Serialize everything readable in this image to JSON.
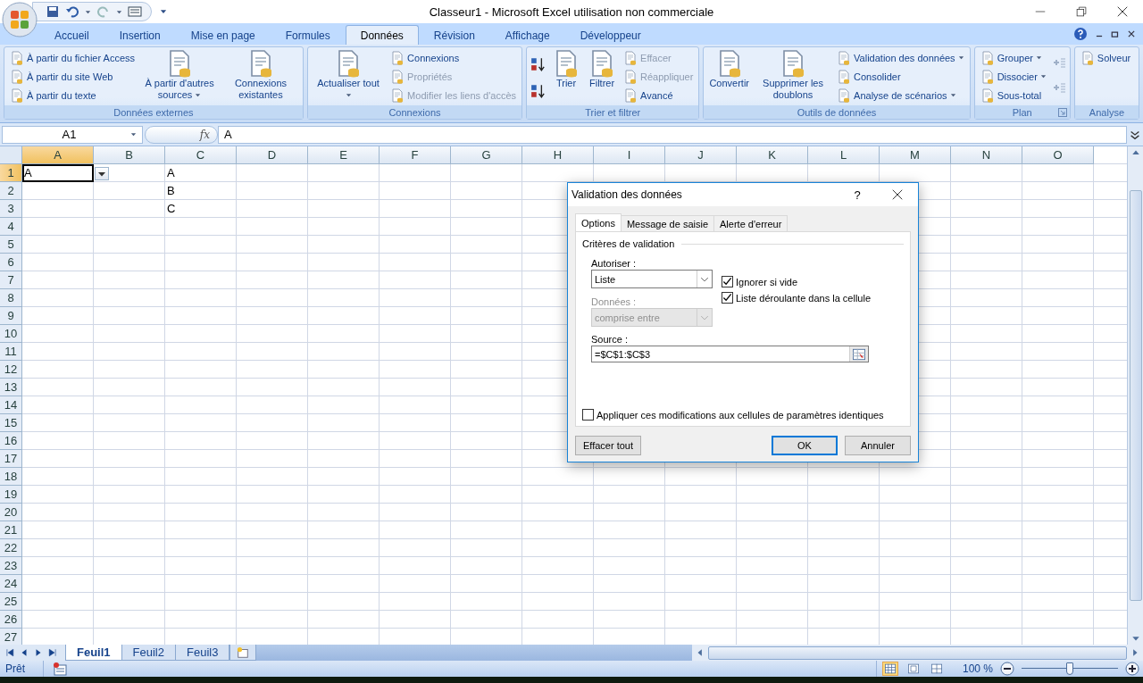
{
  "window": {
    "title": "Classeur1 - Microsoft Excel utilisation non commerciale"
  },
  "tabs": [
    {
      "label": "Accueil",
      "selected": false
    },
    {
      "label": "Insertion",
      "selected": false
    },
    {
      "label": "Mise en page",
      "selected": false
    },
    {
      "label": "Formules",
      "selected": false
    },
    {
      "label": "Données",
      "selected": true
    },
    {
      "label": "Révision",
      "selected": false
    },
    {
      "label": "Affichage",
      "selected": false
    },
    {
      "label": "Développeur",
      "selected": false
    }
  ],
  "ribbon": {
    "groups": [
      {
        "label": "Données externes",
        "launcher": false,
        "items": [
          {
            "kind": "small",
            "label": "À partir du fichier Access",
            "disabled": false,
            "dropdown": false
          },
          {
            "kind": "small",
            "label": "À partir du site Web",
            "disabled": false,
            "dropdown": false
          },
          {
            "kind": "small",
            "label": "À partir du texte",
            "disabled": false,
            "dropdown": false
          },
          {
            "kind": "large",
            "label": "À partir d'autres sources",
            "disabled": false,
            "dropdown": true
          },
          {
            "kind": "large",
            "label": "Connexions existantes",
            "disabled": false,
            "dropdown": false
          }
        ]
      },
      {
        "label": "Connexions",
        "launcher": false,
        "items": [
          {
            "kind": "large",
            "label": "Actualiser tout",
            "disabled": false,
            "dropdown": true
          },
          {
            "kind": "small",
            "label": "Connexions",
            "disabled": false,
            "dropdown": false
          },
          {
            "kind": "small",
            "label": "Propriétés",
            "disabled": true,
            "dropdown": false
          },
          {
            "kind": "small",
            "label": "Modifier les liens d'accès",
            "disabled": true,
            "dropdown": false
          }
        ]
      },
      {
        "label": "Trier et filtrer",
        "launcher": false,
        "items": [
          {
            "kind": "sort"
          },
          {
            "kind": "large",
            "label": "Trier",
            "disabled": false,
            "dropdown": false
          },
          {
            "kind": "large",
            "label": "Filtrer",
            "disabled": false,
            "dropdown": false
          },
          {
            "kind": "small",
            "label": "Effacer",
            "disabled": true,
            "dropdown": false
          },
          {
            "kind": "small",
            "label": "Réappliquer",
            "disabled": true,
            "dropdown": false
          },
          {
            "kind": "small",
            "label": "Avancé",
            "disabled": false,
            "dropdown": false
          }
        ]
      },
      {
        "label": "Outils de données",
        "launcher": false,
        "items": [
          {
            "kind": "large",
            "label": "Convertir",
            "disabled": false,
            "dropdown": false
          },
          {
            "kind": "large",
            "label": "Supprimer les doublons",
            "disabled": false,
            "dropdown": false
          },
          {
            "kind": "small",
            "label": "Validation des données",
            "disabled": false,
            "dropdown": true
          },
          {
            "kind": "small",
            "label": "Consolider",
            "disabled": false,
            "dropdown": false
          },
          {
            "kind": "small",
            "label": "Analyse de scénarios",
            "disabled": false,
            "dropdown": true
          }
        ]
      },
      {
        "label": "Plan",
        "launcher": true,
        "items": [
          {
            "kind": "small",
            "label": "Grouper",
            "disabled": false,
            "dropdown": true
          },
          {
            "kind": "small",
            "label": "Dissocier",
            "disabled": false,
            "dropdown": true
          },
          {
            "kind": "small",
            "label": "Sous-total",
            "disabled": false,
            "dropdown": false
          },
          {
            "kind": "detail"
          }
        ]
      },
      {
        "label": "Analyse",
        "launcher": false,
        "items": [
          {
            "kind": "small",
            "label": "Solveur",
            "disabled": false,
            "dropdown": false
          }
        ]
      }
    ]
  },
  "formula_bar": {
    "name_box": "A1",
    "function_label": "fx",
    "value": "A"
  },
  "sheet": {
    "columns": [
      {
        "label": "A",
        "selected": true
      },
      {
        "label": "B",
        "selected": false
      },
      {
        "label": "C",
        "selected": false
      },
      {
        "label": "D",
        "selected": false
      },
      {
        "label": "E",
        "selected": false
      },
      {
        "label": "F",
        "selected": false
      },
      {
        "label": "G",
        "selected": false
      },
      {
        "label": "H",
        "selected": false
      },
      {
        "label": "I",
        "selected": false
      },
      {
        "label": "J",
        "selected": false
      },
      {
        "label": "K",
        "selected": false
      },
      {
        "label": "L",
        "selected": false
      },
      {
        "label": "M",
        "selected": false
      },
      {
        "label": "N",
        "selected": false
      },
      {
        "label": "O",
        "selected": false
      }
    ],
    "rows": [
      {
        "label": "1",
        "selected": true,
        "cells": [
          {
            "value": "A",
            "active": true
          },
          null,
          {
            "value": "A",
            "active": false
          }
        ]
      },
      {
        "label": "2",
        "selected": false,
        "cells": [
          null,
          null,
          {
            "value": "B",
            "active": false
          }
        ]
      },
      {
        "label": "3",
        "selected": false,
        "cells": [
          null,
          null,
          {
            "value": "C",
            "active": false
          }
        ]
      },
      {
        "label": "4",
        "selected": false
      },
      {
        "label": "5",
        "selected": false
      },
      {
        "label": "6",
        "selected": false
      },
      {
        "label": "7",
        "selected": false
      },
      {
        "label": "8",
        "selected": false
      },
      {
        "label": "9",
        "selected": false
      },
      {
        "label": "10",
        "selected": false
      },
      {
        "label": "11",
        "selected": false
      },
      {
        "label": "12",
        "selected": false
      },
      {
        "label": "13",
        "selected": false
      },
      {
        "label": "14",
        "selected": false
      },
      {
        "label": "15",
        "selected": false
      },
      {
        "label": "16",
        "selected": false
      },
      {
        "label": "17",
        "selected": false
      },
      {
        "label": "18",
        "selected": false
      },
      {
        "label": "19",
        "selected": false
      },
      {
        "label": "20",
        "selected": false
      },
      {
        "label": "21",
        "selected": false
      },
      {
        "label": "22",
        "selected": false
      },
      {
        "label": "23",
        "selected": false
      },
      {
        "label": "24",
        "selected": false
      },
      {
        "label": "25",
        "selected": false
      },
      {
        "label": "26",
        "selected": false
      },
      {
        "label": "27",
        "selected": false
      }
    ],
    "validation_dropdown": true
  },
  "dialog": {
    "title": "Validation des données",
    "help": "?",
    "tabs": [
      {
        "label": "Options",
        "selected": true
      },
      {
        "label": "Message de saisie",
        "selected": false
      },
      {
        "label": "Alerte d'erreur",
        "selected": false
      }
    ],
    "section": "Critères de validation",
    "allow": {
      "label": "Autoriser :",
      "value": "Liste",
      "disabled": false
    },
    "checkboxes": [
      {
        "label": "Ignorer si vide",
        "checked": true
      },
      {
        "label": "Liste déroulante dans la cellule",
        "checked": true
      }
    ],
    "data": {
      "label": "Données :",
      "value": "comprise entre",
      "disabled": true
    },
    "source": {
      "label": "Source :",
      "value": "=$C$1:$C$3"
    },
    "apply_all": {
      "label": "Appliquer ces modifications aux cellules de paramètres identiques",
      "checked": false
    },
    "clear_button": "Effacer tout",
    "buttons": [
      {
        "label": "OK",
        "default": true
      },
      {
        "label": "Annuler",
        "default": false
      }
    ]
  },
  "sheet_tabs": [
    {
      "label": "Feuil1",
      "selected": true
    },
    {
      "label": "Feuil2",
      "selected": false
    },
    {
      "label": "Feuil3",
      "selected": false
    }
  ],
  "status_bar": {
    "text": "Prêt",
    "views": [
      {
        "selected": true
      },
      {
        "selected": false
      },
      {
        "selected": false
      }
    ],
    "zoom": "100 %",
    "level": 0.5
  }
}
